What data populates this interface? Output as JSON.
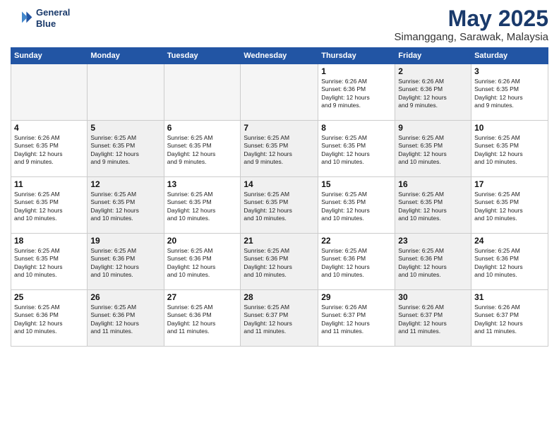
{
  "header": {
    "logo_line1": "General",
    "logo_line2": "Blue",
    "month": "May 2025",
    "location": "Simanggang, Sarawak, Malaysia"
  },
  "weekdays": [
    "Sunday",
    "Monday",
    "Tuesday",
    "Wednesday",
    "Thursday",
    "Friday",
    "Saturday"
  ],
  "weeks": [
    [
      {
        "day": "",
        "info": "",
        "shaded": true
      },
      {
        "day": "",
        "info": "",
        "shaded": true
      },
      {
        "day": "",
        "info": "",
        "shaded": true
      },
      {
        "day": "",
        "info": "",
        "shaded": true
      },
      {
        "day": "1",
        "info": "Sunrise: 6:26 AM\nSunset: 6:36 PM\nDaylight: 12 hours\nand 9 minutes.",
        "shaded": false
      },
      {
        "day": "2",
        "info": "Sunrise: 6:26 AM\nSunset: 6:36 PM\nDaylight: 12 hours\nand 9 minutes.",
        "shaded": true
      },
      {
        "day": "3",
        "info": "Sunrise: 6:26 AM\nSunset: 6:35 PM\nDaylight: 12 hours\nand 9 minutes.",
        "shaded": false
      }
    ],
    [
      {
        "day": "4",
        "info": "Sunrise: 6:26 AM\nSunset: 6:35 PM\nDaylight: 12 hours\nand 9 minutes.",
        "shaded": false
      },
      {
        "day": "5",
        "info": "Sunrise: 6:25 AM\nSunset: 6:35 PM\nDaylight: 12 hours\nand 9 minutes.",
        "shaded": true
      },
      {
        "day": "6",
        "info": "Sunrise: 6:25 AM\nSunset: 6:35 PM\nDaylight: 12 hours\nand 9 minutes.",
        "shaded": false
      },
      {
        "day": "7",
        "info": "Sunrise: 6:25 AM\nSunset: 6:35 PM\nDaylight: 12 hours\nand 9 minutes.",
        "shaded": true
      },
      {
        "day": "8",
        "info": "Sunrise: 6:25 AM\nSunset: 6:35 PM\nDaylight: 12 hours\nand 10 minutes.",
        "shaded": false
      },
      {
        "day": "9",
        "info": "Sunrise: 6:25 AM\nSunset: 6:35 PM\nDaylight: 12 hours\nand 10 minutes.",
        "shaded": true
      },
      {
        "day": "10",
        "info": "Sunrise: 6:25 AM\nSunset: 6:35 PM\nDaylight: 12 hours\nand 10 minutes.",
        "shaded": false
      }
    ],
    [
      {
        "day": "11",
        "info": "Sunrise: 6:25 AM\nSunset: 6:35 PM\nDaylight: 12 hours\nand 10 minutes.",
        "shaded": false
      },
      {
        "day": "12",
        "info": "Sunrise: 6:25 AM\nSunset: 6:35 PM\nDaylight: 12 hours\nand 10 minutes.",
        "shaded": true
      },
      {
        "day": "13",
        "info": "Sunrise: 6:25 AM\nSunset: 6:35 PM\nDaylight: 12 hours\nand 10 minutes.",
        "shaded": false
      },
      {
        "day": "14",
        "info": "Sunrise: 6:25 AM\nSunset: 6:35 PM\nDaylight: 12 hours\nand 10 minutes.",
        "shaded": true
      },
      {
        "day": "15",
        "info": "Sunrise: 6:25 AM\nSunset: 6:35 PM\nDaylight: 12 hours\nand 10 minutes.",
        "shaded": false
      },
      {
        "day": "16",
        "info": "Sunrise: 6:25 AM\nSunset: 6:35 PM\nDaylight: 12 hours\nand 10 minutes.",
        "shaded": true
      },
      {
        "day": "17",
        "info": "Sunrise: 6:25 AM\nSunset: 6:35 PM\nDaylight: 12 hours\nand 10 minutes.",
        "shaded": false
      }
    ],
    [
      {
        "day": "18",
        "info": "Sunrise: 6:25 AM\nSunset: 6:35 PM\nDaylight: 12 hours\nand 10 minutes.",
        "shaded": false
      },
      {
        "day": "19",
        "info": "Sunrise: 6:25 AM\nSunset: 6:36 PM\nDaylight: 12 hours\nand 10 minutes.",
        "shaded": true
      },
      {
        "day": "20",
        "info": "Sunrise: 6:25 AM\nSunset: 6:36 PM\nDaylight: 12 hours\nand 10 minutes.",
        "shaded": false
      },
      {
        "day": "21",
        "info": "Sunrise: 6:25 AM\nSunset: 6:36 PM\nDaylight: 12 hours\nand 10 minutes.",
        "shaded": true
      },
      {
        "day": "22",
        "info": "Sunrise: 6:25 AM\nSunset: 6:36 PM\nDaylight: 12 hours\nand 10 minutes.",
        "shaded": false
      },
      {
        "day": "23",
        "info": "Sunrise: 6:25 AM\nSunset: 6:36 PM\nDaylight: 12 hours\nand 10 minutes.",
        "shaded": true
      },
      {
        "day": "24",
        "info": "Sunrise: 6:25 AM\nSunset: 6:36 PM\nDaylight: 12 hours\nand 10 minutes.",
        "shaded": false
      }
    ],
    [
      {
        "day": "25",
        "info": "Sunrise: 6:25 AM\nSunset: 6:36 PM\nDaylight: 12 hours\nand 10 minutes.",
        "shaded": false
      },
      {
        "day": "26",
        "info": "Sunrise: 6:25 AM\nSunset: 6:36 PM\nDaylight: 12 hours\nand 11 minutes.",
        "shaded": true
      },
      {
        "day": "27",
        "info": "Sunrise: 6:25 AM\nSunset: 6:36 PM\nDaylight: 12 hours\nand 11 minutes.",
        "shaded": false
      },
      {
        "day": "28",
        "info": "Sunrise: 6:25 AM\nSunset: 6:37 PM\nDaylight: 12 hours\nand 11 minutes.",
        "shaded": true
      },
      {
        "day": "29",
        "info": "Sunrise: 6:26 AM\nSunset: 6:37 PM\nDaylight: 12 hours\nand 11 minutes.",
        "shaded": false
      },
      {
        "day": "30",
        "info": "Sunrise: 6:26 AM\nSunset: 6:37 PM\nDaylight: 12 hours\nand 11 minutes.",
        "shaded": true
      },
      {
        "day": "31",
        "info": "Sunrise: 6:26 AM\nSunset: 6:37 PM\nDaylight: 12 hours\nand 11 minutes.",
        "shaded": false
      }
    ]
  ]
}
